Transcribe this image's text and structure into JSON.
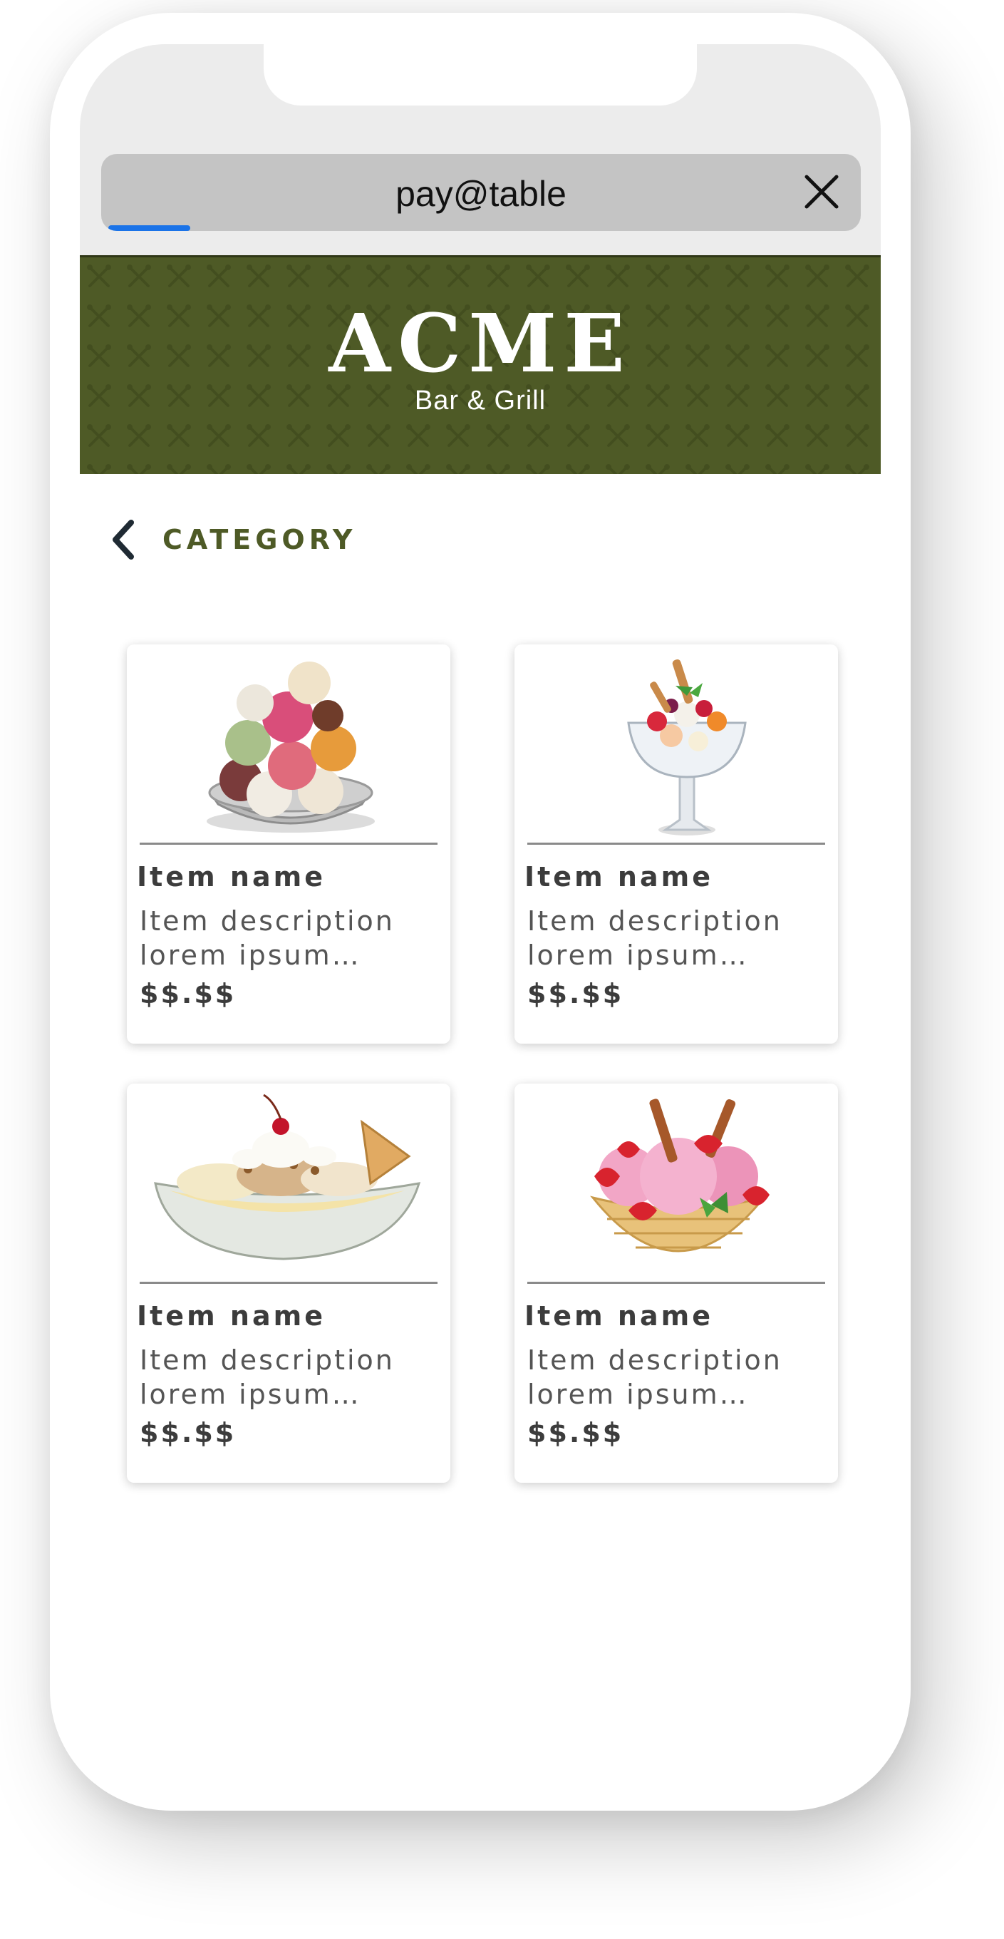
{
  "browser": {
    "url_text": "pay@table",
    "load_progress": 0.11,
    "accent_color": "#1a73e8",
    "close_icon": "close-icon"
  },
  "header": {
    "brand_name": "ACME",
    "brand_tagline": "Bar & Grill",
    "banner_color": "#4e5a26",
    "pattern_icon": "crossed-utensils-icon"
  },
  "nav": {
    "back_icon": "chevron-left-icon",
    "category_label": "CATEGORY"
  },
  "items": [
    {
      "name": "Item name",
      "description": "Item description lorem ipsum…",
      "price": "$$.$$",
      "image": "ice-cream-scoops-bowl"
    },
    {
      "name": "Item name",
      "description": "Item description lorem ipsum…",
      "price": "$$.$$",
      "image": "fruit-sundae-glass"
    },
    {
      "name": "Item name",
      "description": "Item description lorem ipsum…",
      "price": "$$.$$",
      "image": "banana-split-dish"
    },
    {
      "name": "Item name",
      "description": "Item description lorem ipsum…",
      "price": "$$.$$",
      "image": "strawberry-ice-cream-waffle-bowl"
    }
  ]
}
